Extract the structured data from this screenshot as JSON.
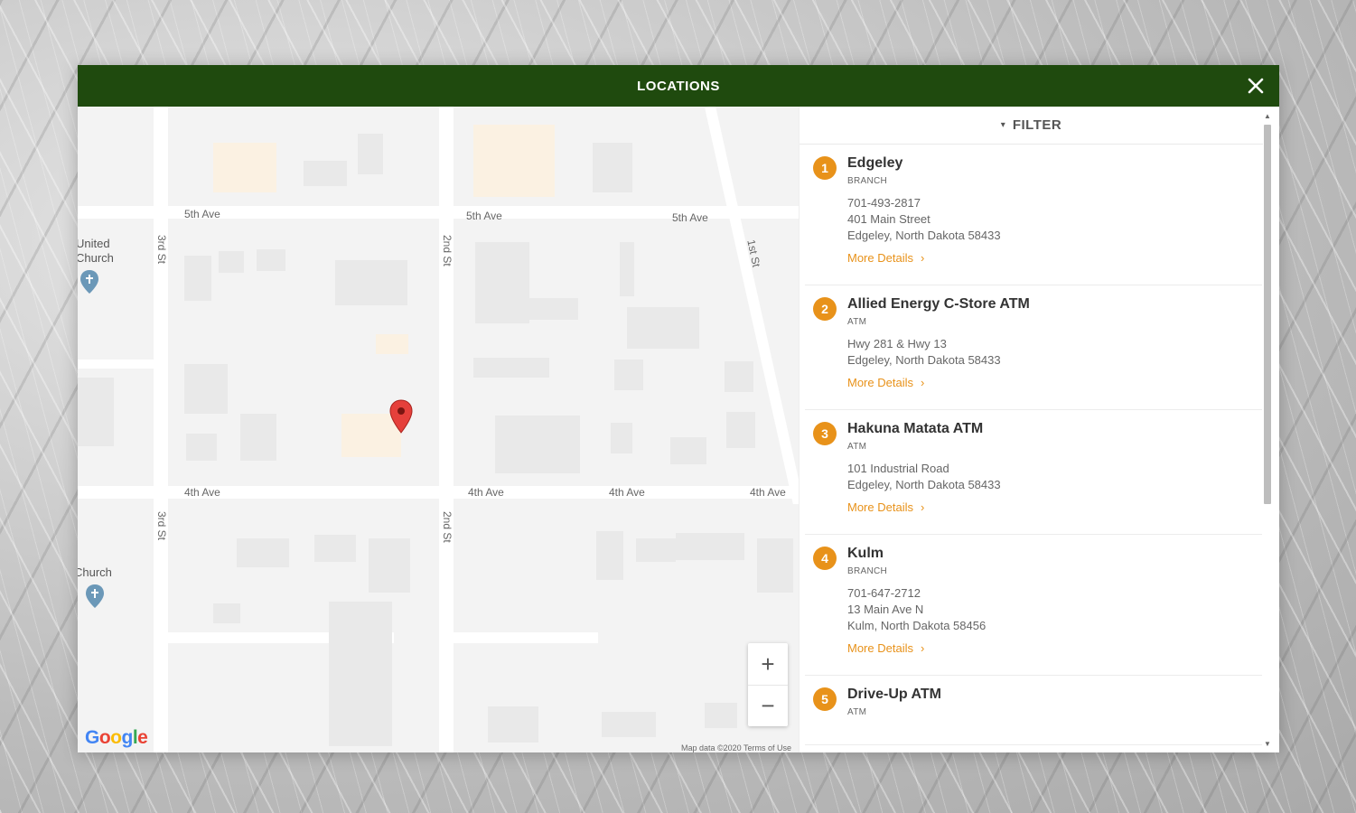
{
  "modal": {
    "title": "LOCATIONS",
    "close_icon": "close-icon"
  },
  "filter": {
    "label": "FILTER",
    "icon": "chevron-down-icon"
  },
  "map": {
    "streets": {
      "ave5_a": "5th Ave",
      "ave5_b": "5th Ave",
      "ave5_c": "5th Ave",
      "ave4_a": "4th Ave",
      "ave4_b": "4th Ave",
      "ave4_c": "4th Ave",
      "ave4_d": "4th Ave",
      "st3_a": "3rd St",
      "st3_b": "3rd St",
      "st2_a": "2nd St",
      "st2_b": "2nd St",
      "st1": "1st St"
    },
    "pois": {
      "united_church_1": "United",
      "united_church_2": "Church",
      "church": "Church"
    },
    "zoom_in": "+",
    "zoom_out": "−",
    "attribution": "Map data ©2020    Terms of Use",
    "google_logo": "Google"
  },
  "locations": [
    {
      "num": "1",
      "name": "Edgeley",
      "type": "BRANCH",
      "lines": [
        "701-493-2817",
        "401 Main Street",
        "Edgeley, North Dakota 58433"
      ],
      "more": "More Details"
    },
    {
      "num": "2",
      "name": "Allied Energy C-Store ATM",
      "type": "ATM",
      "lines": [
        "Hwy 281 & Hwy 13",
        "Edgeley, North Dakota 58433"
      ],
      "more": "More Details"
    },
    {
      "num": "3",
      "name": "Hakuna Matata ATM",
      "type": "ATM",
      "lines": [
        "101 Industrial Road",
        "Edgeley, North Dakota 58433"
      ],
      "more": "More Details"
    },
    {
      "num": "4",
      "name": "Kulm",
      "type": "BRANCH",
      "lines": [
        "701-647-2712",
        "13 Main Ave N",
        "Kulm, North Dakota 58456"
      ],
      "more": "More Details"
    },
    {
      "num": "5",
      "name": "Drive-Up ATM",
      "type": "ATM",
      "lines": [],
      "more": ""
    }
  ],
  "colors": {
    "header_green": "#1f4a0e",
    "accent_orange": "#e8921a"
  }
}
